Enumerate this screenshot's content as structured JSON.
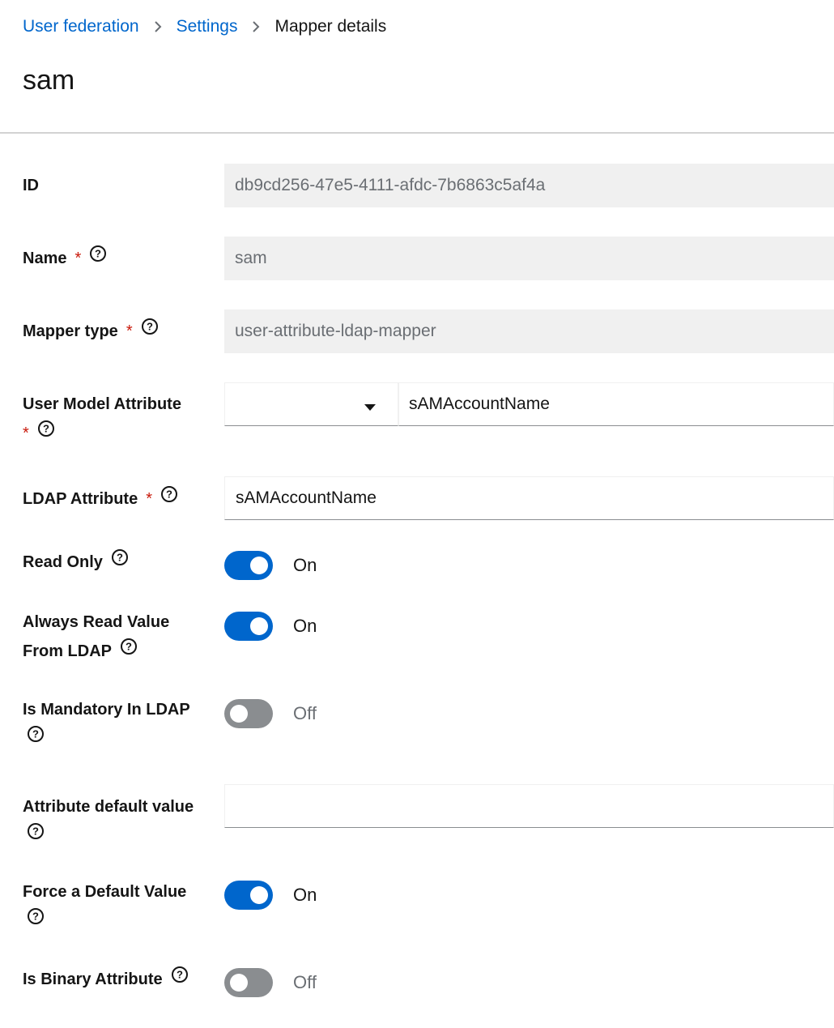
{
  "breadcrumb": {
    "items": [
      "User federation",
      "Settings"
    ],
    "current": "Mapper details"
  },
  "page": {
    "title": "sam"
  },
  "fields": {
    "id": {
      "label": "ID",
      "value": "db9cd256-47e5-4111-afdc-7b6863c5af4a"
    },
    "name": {
      "label": "Name",
      "value": "sam"
    },
    "mapper_type": {
      "label": "Mapper type",
      "value": "user-attribute-ldap-mapper"
    },
    "user_model_attribute": {
      "label": "User Model Attribute",
      "select_value": "",
      "value": "sAMAccountName"
    },
    "ldap_attribute": {
      "label": "LDAP Attribute",
      "value": "sAMAccountName"
    },
    "read_only": {
      "label": "Read Only",
      "state": "On"
    },
    "always_read": {
      "label_line1": "Always Read Value",
      "label_line2": "From LDAP",
      "state": "On"
    },
    "is_mandatory": {
      "label": "Is Mandatory In LDAP",
      "state": "Off"
    },
    "attr_default": {
      "label": "Attribute default value",
      "value": ""
    },
    "force_default": {
      "label": "Force a Default Value",
      "state": "On"
    },
    "is_binary": {
      "label": "Is Binary Attribute",
      "state": "Off"
    }
  },
  "required_marker": "*",
  "colors": {
    "link": "#0066cc",
    "switch_on": "#0066cc",
    "switch_off": "#8a8d90",
    "required": "#c9190b",
    "readonly_bg": "#f0f0f0"
  },
  "icons": {
    "help": "help-circle-icon",
    "separator": "chevron-right-icon",
    "caret": "caret-down-icon"
  }
}
